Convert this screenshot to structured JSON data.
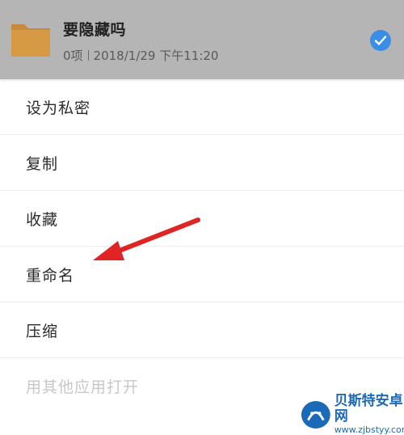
{
  "file": {
    "name": "要隐藏吗",
    "count": "0项",
    "datetime": "2018/1/29 下午11:20",
    "icon": "folder-icon",
    "selected": true
  },
  "menu": [
    {
      "id": "set-private",
      "label": "设为私密",
      "enabled": true
    },
    {
      "id": "copy",
      "label": "复制",
      "enabled": true
    },
    {
      "id": "favorite",
      "label": "收藏",
      "enabled": true
    },
    {
      "id": "rename",
      "label": "重命名",
      "enabled": true
    },
    {
      "id": "compress",
      "label": "压缩",
      "enabled": true
    },
    {
      "id": "open-with",
      "label": "用其他应用打开",
      "enabled": false
    }
  ],
  "watermark": {
    "title": "贝斯特安卓网",
    "url": "www.zjbstyy.com"
  },
  "colors": {
    "accent": "#3a8ee6",
    "arrow": "#e02424",
    "folder": "#d69a45"
  }
}
